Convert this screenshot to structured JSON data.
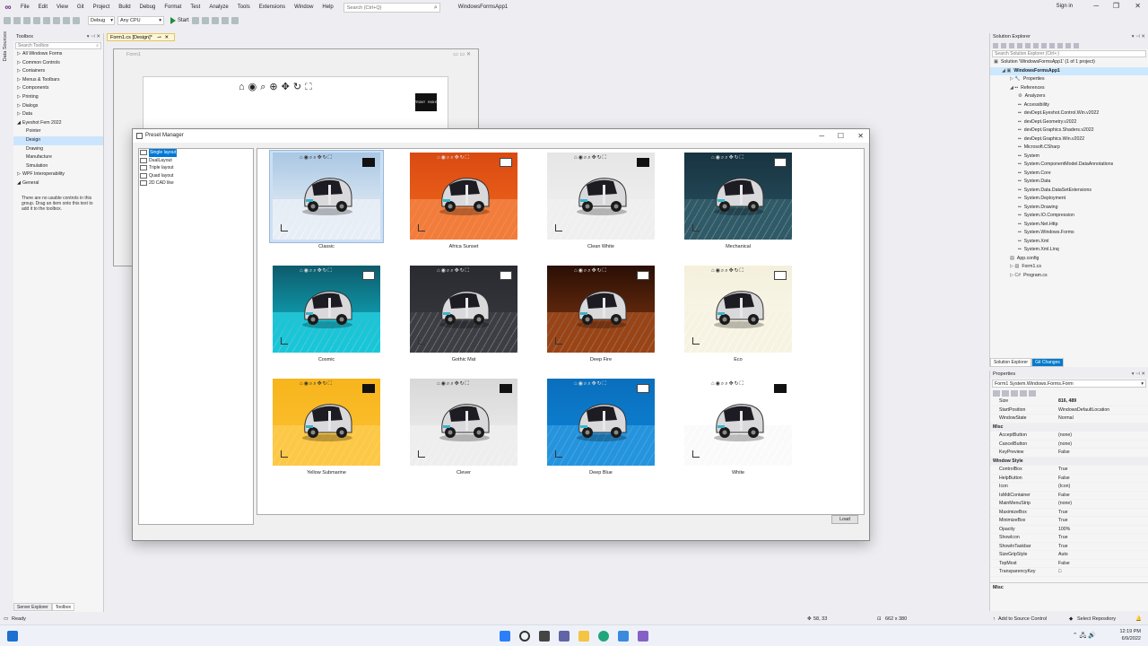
{
  "menubar": {
    "items": [
      "File",
      "Edit",
      "View",
      "Git",
      "Project",
      "Build",
      "Debug",
      "Format",
      "Test",
      "Analyze",
      "Tools",
      "Extensions",
      "Window",
      "Help"
    ],
    "search_placeholder": "Search (Ctrl+Q)",
    "app_title": "WindowsFormsApp1",
    "sign_in": "Sign in"
  },
  "toolbar": {
    "config": "Debug",
    "platform": "Any CPU",
    "start_label": "Start"
  },
  "left_strip": {
    "label": "Data Sources"
  },
  "toolbox": {
    "title": "Toolbox",
    "search_placeholder": "Search Toolbox",
    "rows": [
      {
        "label": "All Windows Forms",
        "arrow": "▷",
        "sub": false
      },
      {
        "label": "Common Controls",
        "arrow": "▷",
        "sub": false
      },
      {
        "label": "Containers",
        "arrow": "▷",
        "sub": false
      },
      {
        "label": "Menus & Toolbars",
        "arrow": "▷",
        "sub": false
      },
      {
        "label": "Components",
        "arrow": "▷",
        "sub": false
      },
      {
        "label": "Printing",
        "arrow": "▷",
        "sub": false
      },
      {
        "label": "Dialogs",
        "arrow": "▷",
        "sub": false
      },
      {
        "label": "Data",
        "arrow": "▷",
        "sub": false
      },
      {
        "label": "Eyeshot Fem 2022",
        "arrow": "◢",
        "sub": false
      },
      {
        "label": "Pointer",
        "arrow": "",
        "sub": true
      },
      {
        "label": "Design",
        "arrow": "",
        "sub": true,
        "sel": true
      },
      {
        "label": "Drawing",
        "arrow": "",
        "sub": true
      },
      {
        "label": "Manufacture",
        "arrow": "",
        "sub": true
      },
      {
        "label": "Simulation",
        "arrow": "",
        "sub": true
      },
      {
        "label": "WPF Interoperability",
        "arrow": "▷",
        "sub": false
      },
      {
        "label": "General",
        "arrow": "◢",
        "sub": false
      }
    ],
    "note": "There are no usable controls in this group. Drag an item onto this text to add it to the toolbox.",
    "bottom_tabs": [
      "Server Explorer",
      "Toolbox"
    ]
  },
  "document": {
    "tab_label": "Form1.cs [Design]*",
    "design_form_title": "Form1"
  },
  "preset_manager": {
    "title": "Preset Manager",
    "layouts": [
      {
        "label": "Single layout",
        "sel": true
      },
      {
        "label": "DualLayout",
        "sel": false
      },
      {
        "label": "Triple layout",
        "sel": false
      },
      {
        "label": "Quad layout",
        "sel": false
      },
      {
        "label": "2D CAD like",
        "sel": false
      }
    ],
    "presets": [
      {
        "label": "Classic",
        "bg_top": "#a9c7e3",
        "bg_bottom": "#f4f7fb",
        "floor": "#e8eef5",
        "cube": "dark",
        "sel": true
      },
      {
        "label": "Africa Sunset",
        "bg_top": "#d94a12",
        "bg_bottom": "#f36a1d",
        "floor": "#f27c3a",
        "cube": "light"
      },
      {
        "label": "Clean White",
        "bg_top": "#e6e6e6",
        "bg_bottom": "#f2f2f2",
        "floor": "#efefef",
        "cube": "dark"
      },
      {
        "label": "Mechanical",
        "bg_top": "#173341",
        "bg_bottom": "#2c5563",
        "floor": "#2f5a68",
        "cube": "light"
      },
      {
        "label": "Cosmic",
        "bg_top": "#0d5b6b",
        "bg_bottom": "#10c3d6",
        "floor": "#19c6d8",
        "cube": "light"
      },
      {
        "label": "Gothic Mat",
        "bg_top": "#2a2b30",
        "bg_bottom": "#3a3c42",
        "floor": "#3c3e44",
        "cube": "light"
      },
      {
        "label": "Deep Fire",
        "bg_top": "#2a0f05",
        "bg_bottom": "#8a3a12",
        "floor": "#9a4416",
        "cube": "light"
      },
      {
        "label": "Eco",
        "bg_top": "#f4f0dc",
        "bg_bottom": "#fbf9ee",
        "floor": "#f7f3e2",
        "cube": "light"
      },
      {
        "label": "Yellow Submarine",
        "bg_top": "#f7b51c",
        "bg_bottom": "#fcc235",
        "floor": "#fcc846",
        "cube": "dark"
      },
      {
        "label": "Clever",
        "bg_top": "#d8d8d8",
        "bg_bottom": "#f2f2f2",
        "floor": "#eeeeee",
        "cube": "dark"
      },
      {
        "label": "Deep Blue",
        "bg_top": "#0a6fbd",
        "bg_bottom": "#0e86d8",
        "floor": "#2494df",
        "cube": "light"
      },
      {
        "label": "White",
        "bg_top": "#ffffff",
        "bg_bottom": "#ffffff",
        "floor": "#fafafa",
        "cube": "dark"
      }
    ],
    "load_label": "Load"
  },
  "solution_explorer": {
    "title": "Solution Explorer",
    "search_placeholder": "Search Solution Explorer (Ctrl+;)",
    "rows": [
      {
        "label": "Solution 'WindowsFormsApp1' (1 of 1 project)",
        "indent": 0,
        "icon": "▣"
      },
      {
        "label": "WindowsFormsApp1",
        "indent": 1,
        "icon": "◢ ▣",
        "bold": true,
        "sel": true
      },
      {
        "label": "Properties",
        "indent": 2,
        "icon": "▷ 🔧"
      },
      {
        "label": "References",
        "indent": 2,
        "icon": "◢ ▪▪"
      },
      {
        "label": "Analyzers",
        "indent": 3,
        "icon": "⚙"
      },
      {
        "label": "Accessibility",
        "indent": 3,
        "icon": "▪▪"
      },
      {
        "label": "devDept.Eyeshot.Control.Win.v2022",
        "indent": 3,
        "icon": "▪▪"
      },
      {
        "label": "devDept.Geometry.v2022",
        "indent": 3,
        "icon": "▪▪"
      },
      {
        "label": "devDept.Graphics.Shaders.v2022",
        "indent": 3,
        "icon": "▪▪"
      },
      {
        "label": "devDept.Graphics.Win.v2022",
        "indent": 3,
        "icon": "▪▪"
      },
      {
        "label": "Microsoft.CSharp",
        "indent": 3,
        "icon": "▪▪"
      },
      {
        "label": "System",
        "indent": 3,
        "icon": "▪▪"
      },
      {
        "label": "System.ComponentModel.DataAnnotations",
        "indent": 3,
        "icon": "▪▪"
      },
      {
        "label": "System.Core",
        "indent": 3,
        "icon": "▪▪"
      },
      {
        "label": "System.Data",
        "indent": 3,
        "icon": "▪▪"
      },
      {
        "label": "System.Data.DataSetExtensions",
        "indent": 3,
        "icon": "▪▪"
      },
      {
        "label": "System.Deployment",
        "indent": 3,
        "icon": "▪▪"
      },
      {
        "label": "System.Drawing",
        "indent": 3,
        "icon": "▪▪"
      },
      {
        "label": "System.IO.Compression",
        "indent": 3,
        "icon": "▪▪"
      },
      {
        "label": "System.Net.Http",
        "indent": 3,
        "icon": "▪▪"
      },
      {
        "label": "System.Windows.Forms",
        "indent": 3,
        "icon": "▪▪"
      },
      {
        "label": "System.Xml",
        "indent": 3,
        "icon": "▪▪"
      },
      {
        "label": "System.Xml.Linq",
        "indent": 3,
        "icon": "▪▪"
      },
      {
        "label": "App.config",
        "indent": 2,
        "icon": "▤"
      },
      {
        "label": "Form1.cs",
        "indent": 2,
        "icon": "▷ ▤"
      },
      {
        "label": "Program.cs",
        "indent": 2,
        "icon": "▷ C#"
      }
    ],
    "tabs": [
      "Solution Explorer",
      "Git Changes"
    ]
  },
  "properties": {
    "title": "Properties",
    "object": "Form1  System.Windows.Forms.Form",
    "rows": [
      {
        "name": "Size",
        "value": "816, 489",
        "bold": true,
        "expand": true
      },
      {
        "name": "StartPosition",
        "value": "WindowsDefaultLocation"
      },
      {
        "name": "WindowState",
        "value": "Normal"
      },
      {
        "name": "Misc",
        "value": "",
        "cat": true
      },
      {
        "name": "AcceptButton",
        "value": "(none)"
      },
      {
        "name": "CancelButton",
        "value": "(none)"
      },
      {
        "name": "KeyPreview",
        "value": "False"
      },
      {
        "name": "Window Style",
        "value": "",
        "cat": true
      },
      {
        "name": "ControlBox",
        "value": "True"
      },
      {
        "name": "HelpButton",
        "value": "False"
      },
      {
        "name": "Icon",
        "value": "(Icon)",
        "expand": true
      },
      {
        "name": "IsMdiContainer",
        "value": "False"
      },
      {
        "name": "MainMenuStrip",
        "value": "(none)"
      },
      {
        "name": "MaximizeBox",
        "value": "True"
      },
      {
        "name": "MinimizeBox",
        "value": "True"
      },
      {
        "name": "Opacity",
        "value": "100%"
      },
      {
        "name": "ShowIcon",
        "value": "True"
      },
      {
        "name": "ShowInTaskbar",
        "value": "True"
      },
      {
        "name": "SizeGripStyle",
        "value": "Auto"
      },
      {
        "name": "TopMost",
        "value": "False"
      },
      {
        "name": "TransparencyKey",
        "value": "□"
      }
    ],
    "description_title": "Misc"
  },
  "statusbar": {
    "ready": "Ready",
    "position": "58, 33",
    "size": "662 x 380",
    "source_control": "Add to Source Control",
    "repo": "Select Repository"
  },
  "taskbar": {
    "time": "12:19 PM",
    "date": "6/9/2022"
  },
  "colors": {
    "accent": "#007acc",
    "vs_purple": "#68217a",
    "selection": "#0078d7"
  }
}
